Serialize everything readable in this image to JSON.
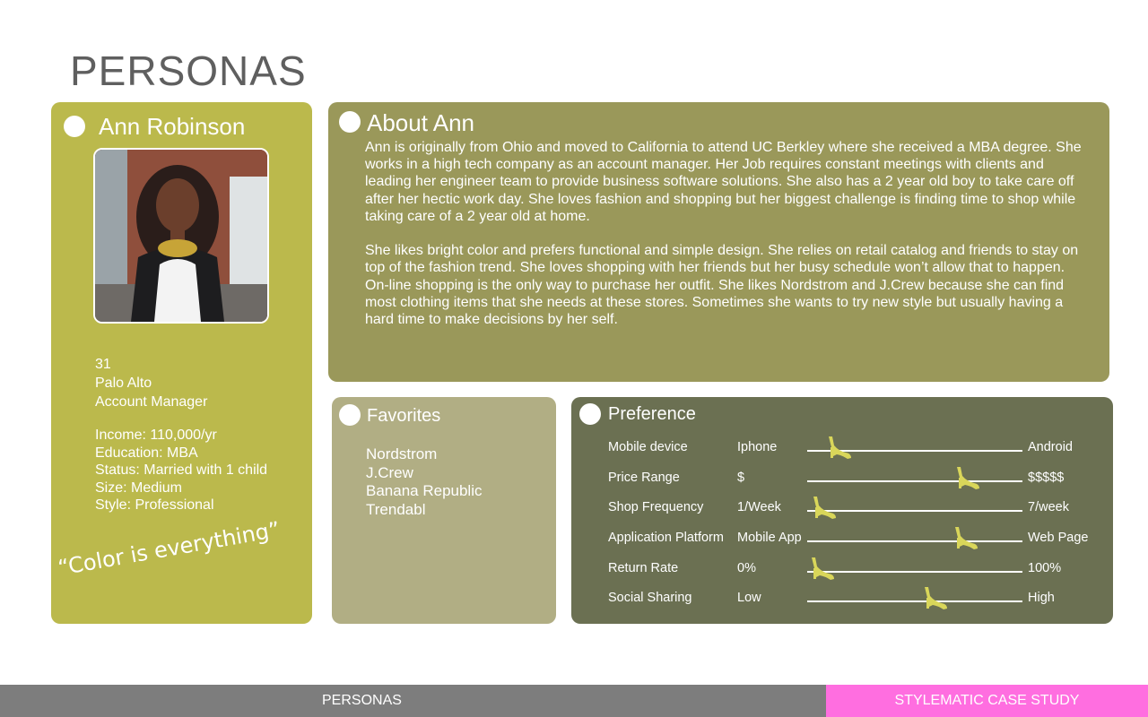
{
  "page": {
    "title": "PERSONAS"
  },
  "persona": {
    "name": "Ann Robinson",
    "age": "31",
    "location": "Palo Alto",
    "job": "Account Manager",
    "income": "Income: 110,000/yr",
    "education": "Education: MBA",
    "status": "Status: Married with 1 child",
    "size": "Size: Medium",
    "style": "Style: Professional",
    "quote": "“Color is everything”",
    "photo_icon": "persona-photo",
    "card_color": "#bbb94c"
  },
  "about": {
    "title": "About Ann",
    "paragraph1": "Ann is originally from Ohio and moved to California to attend UC Berkley where she received a MBA degree. She works in a high tech company as an account manager. Her Job requires constant meetings with clients and leading her engineer team to provide business software solutions. She also has a 2 year old boy to take care off after her hectic work day. She loves fashion and shopping but her biggest challenge is finding time to shop while taking care of a 2 year old at home.",
    "paragraph2": "She likes bright color and prefers functional and simple design. She relies on retail catalog and friends to stay on top of the fashion trend. She loves shopping with her friends but her busy schedule won’t allow that to happen. On-line shopping is the only way to purchase her outfit. She likes Nordstrom and J.Crew because she can find most clothing items that she needs at these stores. Sometimes she wants to try new style but usually having a hard time to make decisions by her self."
  },
  "favorites": {
    "title": "Favorites",
    "items": [
      "Nordstrom",
      "J.Crew",
      "Banana Republic",
      "Trendabl"
    ]
  },
  "preference": {
    "title": "Preference",
    "marker_icon": "high-heel-icon",
    "marker_color": "#d9d65a",
    "rows": [
      {
        "label": "Mobile device",
        "low": "Iphone",
        "high": "Android",
        "level": 0.1
      },
      {
        "label": "Price Range",
        "low": "$",
        "high": "$$$$$",
        "level": 0.78
      },
      {
        "label": "Shop Frequency",
        "low": "1/Week",
        "high": "7/week",
        "level": 0.02
      },
      {
        "label": "Application Platform",
        "low": "Mobile App",
        "high": "Web Page",
        "level": 0.77
      },
      {
        "label": "Return Rate",
        "low": "0%",
        "high": "100%",
        "level": 0.01
      },
      {
        "label": "Social Sharing",
        "low": "Low",
        "high": "High",
        "level": 0.61
      }
    ]
  },
  "footer": {
    "left_label": "PERSONAS",
    "right_label": "STYLEMATIC CASE STUDY",
    "left_color": "#7d7d7d",
    "right_color": "#ff6ee0"
  }
}
